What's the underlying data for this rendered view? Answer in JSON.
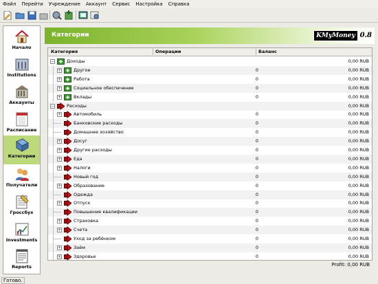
{
  "menu": [
    "Файл",
    "Перейти",
    "Учреждение",
    "Аккаунт",
    "Сервис",
    "Настройка",
    "Справка"
  ],
  "toolbar": {
    "buttons": [
      "new-file-icon",
      "open-icon",
      "save-icon",
      "save-as-icon",
      "account-add-icon",
      "account-edit-icon",
      "export-icon",
      "search-icon"
    ]
  },
  "sidebar": {
    "items": [
      {
        "label": "Начало",
        "icon": "home-icon"
      },
      {
        "label": "Institutions",
        "icon": "institutions-icon"
      },
      {
        "label": "Аккаунты",
        "icon": "accounts-icon"
      },
      {
        "label": "Расписание",
        "icon": "schedule-icon"
      },
      {
        "label": "Категории",
        "icon": "categories-icon",
        "active": true
      },
      {
        "label": "Получатели",
        "icon": "payees-icon"
      },
      {
        "label": "Гроссбух",
        "icon": "ledger-icon"
      },
      {
        "label": "Investments",
        "icon": "investments-icon"
      },
      {
        "label": "Reports",
        "icon": "reports-icon"
      }
    ]
  },
  "header": {
    "title": "Категории",
    "logo_main": "KMyMoney",
    "logo_version": "0.8"
  },
  "table": {
    "columns": [
      "Категория",
      "Операции",
      "Баланс"
    ],
    "rows": [
      {
        "name": "Доходы",
        "level": 0,
        "type": "income",
        "expander": "−",
        "ops": "",
        "balance": "0,00 RUB"
      },
      {
        "name": "Другое",
        "level": 1,
        "type": "income",
        "expander": "+",
        "ops": "0",
        "balance": "0,00 RUB"
      },
      {
        "name": "Работа",
        "level": 1,
        "type": "income",
        "expander": "+",
        "ops": "0",
        "balance": "0,00 RUB"
      },
      {
        "name": "Социальное обеспечение",
        "level": 1,
        "type": "income",
        "expander": "+",
        "ops": "0",
        "balance": "0,00 RUB"
      },
      {
        "name": "Вклады",
        "level": 1,
        "type": "income",
        "expander": "+",
        "ops": "0",
        "balance": "0,00 RUB"
      },
      {
        "name": "Расходы",
        "level": 0,
        "type": "expense",
        "expander": "−",
        "ops": "",
        "balance": "0,00 RUB"
      },
      {
        "name": "Автомобиль",
        "level": 1,
        "type": "expense",
        "expander": "+",
        "ops": "0",
        "balance": "0,00 RUB"
      },
      {
        "name": "Банковские расходы",
        "level": 1,
        "type": "expense",
        "expander": "",
        "ops": "0",
        "balance": "0,00 RUB"
      },
      {
        "name": "Домашнее хозяйство",
        "level": 1,
        "type": "expense",
        "expander": "",
        "ops": "0",
        "balance": "0,00 RUB"
      },
      {
        "name": "Досуг",
        "level": 1,
        "type": "expense",
        "expander": "+",
        "ops": "0",
        "balance": "0,00 RUB"
      },
      {
        "name": "Другие расходы",
        "level": 1,
        "type": "expense",
        "expander": "+",
        "ops": "0",
        "balance": "0,00 RUB"
      },
      {
        "name": "Еда",
        "level": 1,
        "type": "expense",
        "expander": "+",
        "ops": "0",
        "balance": "0,00 RUB"
      },
      {
        "name": "Налоги",
        "level": 1,
        "type": "expense",
        "expander": "+",
        "ops": "0",
        "balance": "0,00 RUB"
      },
      {
        "name": "Новый год",
        "level": 1,
        "type": "expense",
        "expander": "",
        "ops": "0",
        "balance": "0,00 RUB"
      },
      {
        "name": "Образование",
        "level": 1,
        "type": "expense",
        "expander": "+",
        "ops": "0",
        "balance": "0,00 RUB"
      },
      {
        "name": "Одежда",
        "level": 1,
        "type": "expense",
        "expander": "",
        "ops": "0",
        "balance": "0,00 RUB"
      },
      {
        "name": "Отпуск",
        "level": 1,
        "type": "expense",
        "expander": "+",
        "ops": "0",
        "balance": "0,00 RUB"
      },
      {
        "name": "Повышение квалификации",
        "level": 1,
        "type": "expense",
        "expander": "",
        "ops": "0",
        "balance": "0,00 RUB"
      },
      {
        "name": "Страховка",
        "level": 1,
        "type": "expense",
        "expander": "+",
        "ops": "0",
        "balance": "0,00 RUB"
      },
      {
        "name": "Счета",
        "level": 1,
        "type": "expense",
        "expander": "+",
        "ops": "0",
        "balance": "0,00 RUB"
      },
      {
        "name": "Уход за ребёнком",
        "level": 1,
        "type": "expense",
        "expander": "",
        "ops": "0",
        "balance": "0,00 RUB"
      },
      {
        "name": "Заём",
        "level": 1,
        "type": "expense",
        "expander": "+",
        "ops": "0",
        "balance": "0,00 RUB"
      },
      {
        "name": "Здоровье",
        "level": 1,
        "type": "expense",
        "expander": "+",
        "ops": "0",
        "balance": "0,00 RUB"
      }
    ]
  },
  "profit_text": "Profit: 0,00 RUB",
  "status_text": "Готово.",
  "colors": {
    "accent_green": "#7bb32a",
    "active_sidebar": "#bcd97c",
    "income_icon": "#3a9a2a",
    "expense_icon": "#c01818"
  }
}
